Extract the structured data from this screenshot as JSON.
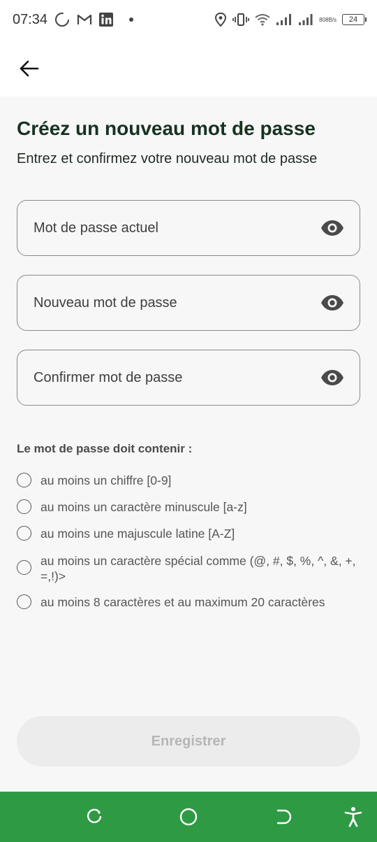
{
  "status_bar": {
    "time": "07:34",
    "net_speed_value": "808",
    "net_speed_unit": "B/s",
    "battery": "24",
    "icons": [
      "loading-circle-icon",
      "gmail-icon",
      "linkedin-icon",
      "dot-icon",
      "location-icon",
      "vibrate-icon",
      "wifi-icon",
      "signal-icon",
      "signal-icon",
      "battery-icon"
    ]
  },
  "header": {
    "back_icon": "arrow-left-icon"
  },
  "page": {
    "title": "Créez un nouveau mot de passe",
    "subtitle": "Entrez et confirmez votre nouveau mot de passe"
  },
  "fields": {
    "current": {
      "placeholder": "Mot de passe actuel",
      "value": ""
    },
    "new": {
      "placeholder": "Nouveau mot de passe",
      "value": ""
    },
    "confirm": {
      "placeholder": "Confirmer mot de passe",
      "value": ""
    },
    "visibility_icon": "eye-icon"
  },
  "requirements": {
    "heading": "Le mot de passe doit contenir :",
    "items": [
      "au moins un chiffre [0-9]",
      "au moins un caractère minuscule [a-z]",
      "au moins une majuscule latine [A-Z]",
      "au moins un caractère spécial comme (@, #, $, %, ^, &, +, =,!)>",
      "au moins 8 caractères et au maximum 20 caractères"
    ]
  },
  "actions": {
    "save_label": "Enregistrer"
  },
  "nav_bar": {
    "icons": [
      "recent-apps-icon",
      "home-icon",
      "back-icon",
      "accessibility-icon"
    ]
  },
  "colors": {
    "title": "#16331f",
    "nav_bar": "#2e9a44",
    "save_disabled_bg": "#ececec",
    "save_disabled_text": "#b6b6b6"
  }
}
